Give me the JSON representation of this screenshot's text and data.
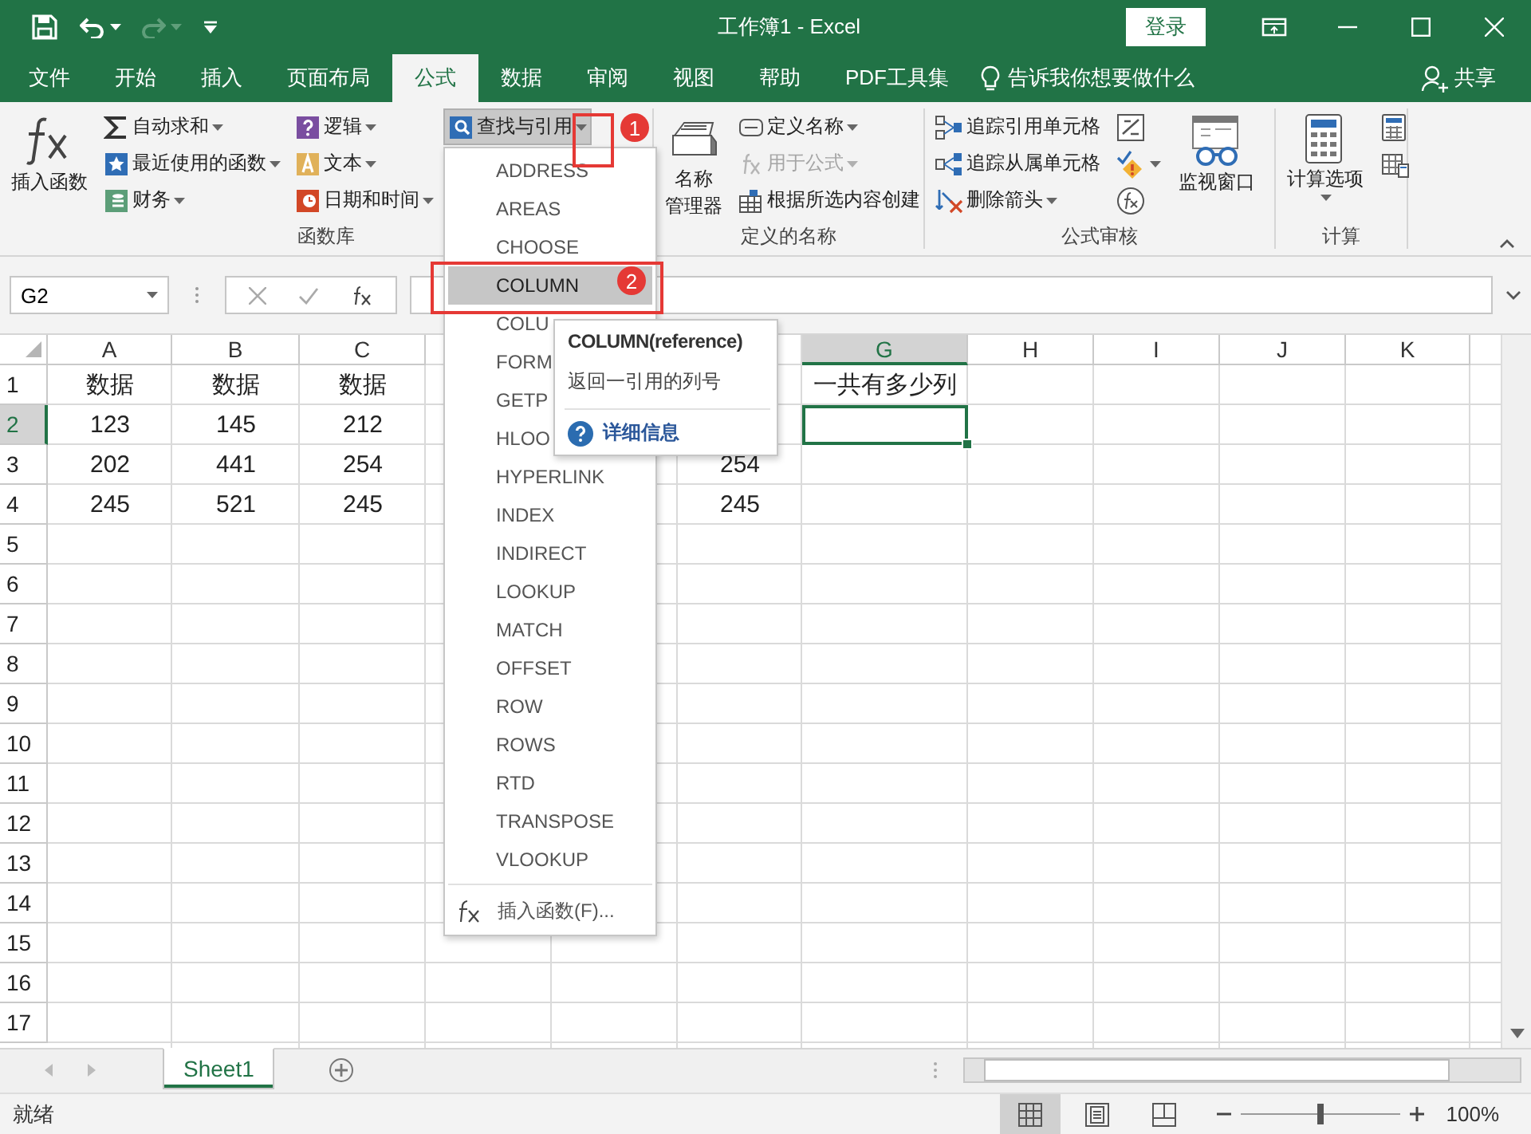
{
  "window": {
    "title": "工作簿1 - Excel",
    "sign_in": "登录"
  },
  "quick_access": [
    {
      "kind": "save",
      "disabled": false
    },
    {
      "kind": "undo",
      "disabled": false
    },
    {
      "kind": "redo",
      "disabled": true
    },
    {
      "kind": "customize",
      "disabled": false
    }
  ],
  "tabs": [
    {
      "label": "文件",
      "selected": false
    },
    {
      "label": "开始",
      "selected": false
    },
    {
      "label": "插入",
      "selected": false
    },
    {
      "label": "页面布局",
      "selected": false
    },
    {
      "label": "公式",
      "selected": true
    },
    {
      "label": "数据",
      "selected": false
    },
    {
      "label": "审阅",
      "selected": false
    },
    {
      "label": "视图",
      "selected": false
    },
    {
      "label": "帮助",
      "selected": false
    },
    {
      "label": "PDF工具集",
      "selected": false
    }
  ],
  "tell_me": "告诉我你想要做什么",
  "share": "共享",
  "ribbon": {
    "groups": [
      {
        "label": "函数库",
        "columns": [
          [
            {
              "kind": "big",
              "label": "插入函数",
              "dropdown": false,
              "disabled": false,
              "expanded": false
            }
          ],
          [
            {
              "kind": "small",
              "label": "自动求和",
              "dropdown": true,
              "disabled": false,
              "expanded": false
            },
            {
              "kind": "small",
              "label": "最近使用的函数",
              "dropdown": true,
              "disabled": false,
              "expanded": false
            },
            {
              "kind": "small",
              "label": "财务",
              "dropdown": true,
              "disabled": false,
              "expanded": false
            }
          ],
          [
            {
              "kind": "small",
              "label": "逻辑",
              "dropdown": true,
              "disabled": false,
              "expanded": false
            },
            {
              "kind": "small",
              "label": "文本",
              "dropdown": true,
              "disabled": false,
              "expanded": false
            },
            {
              "kind": "small",
              "label": "日期和时间",
              "dropdown": true,
              "disabled": false,
              "expanded": false
            }
          ],
          [
            {
              "kind": "small",
              "label": "查找与引用",
              "dropdown": true,
              "disabled": false,
              "expanded": true
            }
          ]
        ]
      },
      {
        "label": "定义的名称",
        "columns": [
          [
            {
              "kind": "big",
              "lines": [
                "名称",
                "管理器"
              ],
              "dropdown": false,
              "disabled": false,
              "expanded": false
            }
          ],
          [
            {
              "kind": "small",
              "label": "定义名称",
              "dropdown": true,
              "disabled": false,
              "expanded": false
            },
            {
              "kind": "small",
              "label": "用于公式",
              "dropdown": true,
              "disabled": true,
              "expanded": false
            },
            {
              "kind": "small",
              "label": "根据所选内容创建",
              "dropdown": false,
              "disabled": false,
              "expanded": false
            }
          ]
        ]
      },
      {
        "label": "公式审核",
        "columns": [
          [
            {
              "kind": "small",
              "label": "追踪引用单元格",
              "dropdown": false,
              "disabled": false,
              "expanded": false
            },
            {
              "kind": "small",
              "label": "追踪从属单元格",
              "dropdown": false,
              "disabled": false,
              "expanded": false
            },
            {
              "kind": "small",
              "label": "删除箭头",
              "dropdown": true,
              "disabled": false,
              "expanded": false
            }
          ],
          [
            {
              "kind": "icon",
              "dropdown": false,
              "disabled": false,
              "expanded": false
            },
            {
              "kind": "icon",
              "dropdown": true,
              "disabled": false,
              "expanded": false
            },
            {
              "kind": "icon",
              "dropdown": false,
              "disabled": false,
              "expanded": false
            }
          ],
          [
            {
              "kind": "big",
              "label": "监视窗口",
              "dropdown": false,
              "disabled": false,
              "expanded": false
            }
          ]
        ]
      },
      {
        "label": "计算",
        "columns": [
          [
            {
              "kind": "big",
              "label": "计算选项",
              "dropdown": true,
              "disabled": false,
              "expanded": false
            }
          ],
          [
            {
              "kind": "icon",
              "dropdown": false,
              "disabled": false,
              "expanded": false
            },
            {
              "kind": "icon",
              "dropdown": false,
              "disabled": false,
              "expanded": false
            }
          ]
        ]
      }
    ]
  },
  "formula_bar": {
    "name_box": "G2"
  },
  "grid": {
    "columns": [
      {
        "label": "A",
        "selected": false
      },
      {
        "label": "B",
        "selected": false
      },
      {
        "label": "C",
        "selected": false
      },
      null,
      null,
      null,
      {
        "label": "G",
        "selected": true
      },
      {
        "label": "H",
        "selected": false
      },
      {
        "label": "I",
        "selected": false
      },
      {
        "label": "J",
        "selected": false
      },
      {
        "label": "K",
        "selected": false
      }
    ],
    "rows": [
      {
        "label": "1",
        "selected": false,
        "cells": [
          "数据",
          "数据",
          "数据",
          null,
          null,
          null,
          "一共有多少列",
          null,
          null,
          null,
          null
        ]
      },
      {
        "label": "2",
        "selected": true,
        "cells": [
          "123",
          "145",
          "212",
          null,
          null,
          null,
          null,
          null,
          null,
          null,
          null
        ]
      },
      {
        "label": "3",
        "selected": false,
        "cells": [
          "202",
          "441",
          "254",
          null,
          null,
          "254",
          null,
          null,
          null,
          null,
          null
        ]
      },
      {
        "label": "4",
        "selected": false,
        "cells": [
          "245",
          "521",
          "245",
          null,
          null,
          "245",
          null,
          null,
          null,
          null,
          null
        ]
      },
      {
        "label": "5",
        "selected": false,
        "cells": []
      },
      {
        "label": "6",
        "selected": false,
        "cells": []
      },
      {
        "label": "7",
        "selected": false,
        "cells": []
      },
      {
        "label": "8",
        "selected": false,
        "cells": []
      },
      {
        "label": "9",
        "selected": false,
        "cells": []
      },
      {
        "label": "10",
        "selected": false,
        "cells": []
      },
      {
        "label": "11",
        "selected": false,
        "cells": []
      },
      {
        "label": "12",
        "selected": false,
        "cells": []
      },
      {
        "label": "13",
        "selected": false,
        "cells": []
      },
      {
        "label": "14",
        "selected": false,
        "cells": []
      },
      {
        "label": "15",
        "selected": false,
        "cells": []
      },
      {
        "label": "16",
        "selected": false,
        "cells": []
      },
      {
        "label": "17",
        "selected": false,
        "cells": []
      }
    ]
  },
  "sheets": [
    {
      "label": "Sheet1",
      "selected": true
    }
  ],
  "status": "就绪",
  "views": [
    {
      "selected": true
    },
    {
      "selected": false
    },
    {
      "selected": false
    }
  ],
  "zoom": {
    "level": 0.5,
    "reading": "100%"
  },
  "dropdown": {
    "items": [
      {
        "label": "ADDRESS",
        "selected": false
      },
      {
        "label": "AREAS",
        "selected": false
      },
      {
        "label": "CHOOSE",
        "selected": false
      },
      {
        "label": "COLUMN",
        "selected": true
      },
      {
        "label": "COLU",
        "selected": false
      },
      {
        "label": "FORM",
        "selected": false
      },
      {
        "label": "GETP",
        "selected": false
      },
      {
        "label": "HLOO",
        "selected": false
      },
      {
        "label": "HYPERLINK",
        "selected": false
      },
      {
        "label": "INDEX",
        "selected": false
      },
      {
        "label": "INDIRECT",
        "selected": false
      },
      {
        "label": "LOOKUP",
        "selected": false
      },
      {
        "label": "MATCH",
        "selected": false
      },
      {
        "label": "OFFSET",
        "selected": false
      },
      {
        "label": "ROW",
        "selected": false
      },
      {
        "label": "ROWS",
        "selected": false
      },
      {
        "label": "RTD",
        "selected": false
      },
      {
        "label": "TRANSPOSE",
        "selected": false
      },
      {
        "label": "VLOOKUP",
        "selected": false
      }
    ],
    "footer": "插入函数(F)..."
  },
  "tooltip": {
    "title": "COLUMN(reference)",
    "description": "返回一引用的列号",
    "link": "详细信息"
  },
  "annotations": [
    {
      "label": "1"
    },
    {
      "label": "2"
    }
  ]
}
